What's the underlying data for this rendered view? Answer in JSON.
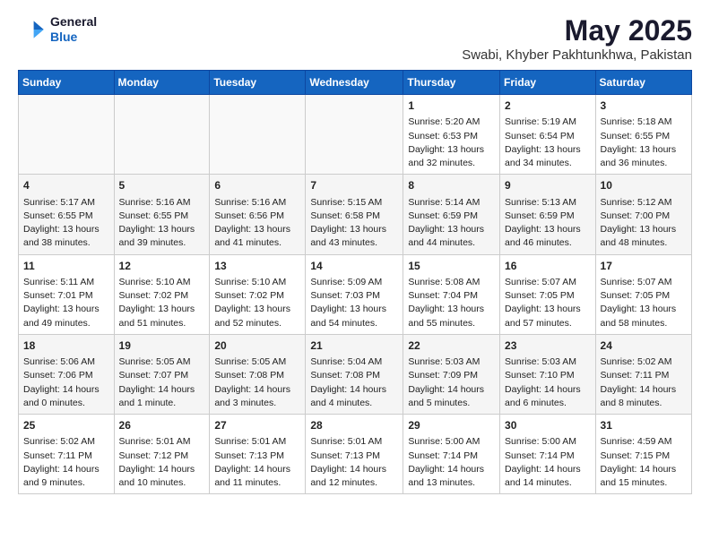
{
  "header": {
    "logo_line1": "General",
    "logo_line2": "Blue",
    "title": "May 2025",
    "subtitle": "Swabi, Khyber Pakhtunkhwa, Pakistan"
  },
  "days_of_week": [
    "Sunday",
    "Monday",
    "Tuesday",
    "Wednesday",
    "Thursday",
    "Friday",
    "Saturday"
  ],
  "weeks": [
    [
      {
        "day": "",
        "info": ""
      },
      {
        "day": "",
        "info": ""
      },
      {
        "day": "",
        "info": ""
      },
      {
        "day": "",
        "info": ""
      },
      {
        "day": "1",
        "info": "Sunrise: 5:20 AM\nSunset: 6:53 PM\nDaylight: 13 hours\nand 32 minutes."
      },
      {
        "day": "2",
        "info": "Sunrise: 5:19 AM\nSunset: 6:54 PM\nDaylight: 13 hours\nand 34 minutes."
      },
      {
        "day": "3",
        "info": "Sunrise: 5:18 AM\nSunset: 6:55 PM\nDaylight: 13 hours\nand 36 minutes."
      }
    ],
    [
      {
        "day": "4",
        "info": "Sunrise: 5:17 AM\nSunset: 6:55 PM\nDaylight: 13 hours\nand 38 minutes."
      },
      {
        "day": "5",
        "info": "Sunrise: 5:16 AM\nSunset: 6:55 PM\nDaylight: 13 hours\nand 39 minutes."
      },
      {
        "day": "6",
        "info": "Sunrise: 5:16 AM\nSunset: 6:56 PM\nDaylight: 13 hours\nand 41 minutes."
      },
      {
        "day": "7",
        "info": "Sunrise: 5:15 AM\nSunset: 6:58 PM\nDaylight: 13 hours\nand 43 minutes."
      },
      {
        "day": "8",
        "info": "Sunrise: 5:14 AM\nSunset: 6:59 PM\nDaylight: 13 hours\nand 44 minutes."
      },
      {
        "day": "9",
        "info": "Sunrise: 5:13 AM\nSunset: 6:59 PM\nDaylight: 13 hours\nand 46 minutes."
      },
      {
        "day": "10",
        "info": "Sunrise: 5:12 AM\nSunset: 7:00 PM\nDaylight: 13 hours\nand 48 minutes."
      }
    ],
    [
      {
        "day": "11",
        "info": "Sunrise: 5:11 AM\nSunset: 7:01 PM\nDaylight: 13 hours\nand 49 minutes."
      },
      {
        "day": "12",
        "info": "Sunrise: 5:10 AM\nSunset: 7:02 PM\nDaylight: 13 hours\nand 51 minutes."
      },
      {
        "day": "13",
        "info": "Sunrise: 5:10 AM\nSunset: 7:02 PM\nDaylight: 13 hours\nand 52 minutes."
      },
      {
        "day": "14",
        "info": "Sunrise: 5:09 AM\nSunset: 7:03 PM\nDaylight: 13 hours\nand 54 minutes."
      },
      {
        "day": "15",
        "info": "Sunrise: 5:08 AM\nSunset: 7:04 PM\nDaylight: 13 hours\nand 55 minutes."
      },
      {
        "day": "16",
        "info": "Sunrise: 5:07 AM\nSunset: 7:05 PM\nDaylight: 13 hours\nand 57 minutes."
      },
      {
        "day": "17",
        "info": "Sunrise: 5:07 AM\nSunset: 7:05 PM\nDaylight: 13 hours\nand 58 minutes."
      }
    ],
    [
      {
        "day": "18",
        "info": "Sunrise: 5:06 AM\nSunset: 7:06 PM\nDaylight: 14 hours\nand 0 minutes."
      },
      {
        "day": "19",
        "info": "Sunrise: 5:05 AM\nSunset: 7:07 PM\nDaylight: 14 hours\nand 1 minute."
      },
      {
        "day": "20",
        "info": "Sunrise: 5:05 AM\nSunset: 7:08 PM\nDaylight: 14 hours\nand 3 minutes."
      },
      {
        "day": "21",
        "info": "Sunrise: 5:04 AM\nSunset: 7:08 PM\nDaylight: 14 hours\nand 4 minutes."
      },
      {
        "day": "22",
        "info": "Sunrise: 5:03 AM\nSunset: 7:09 PM\nDaylight: 14 hours\nand 5 minutes."
      },
      {
        "day": "23",
        "info": "Sunrise: 5:03 AM\nSunset: 7:10 PM\nDaylight: 14 hours\nand 6 minutes."
      },
      {
        "day": "24",
        "info": "Sunrise: 5:02 AM\nSunset: 7:11 PM\nDaylight: 14 hours\nand 8 minutes."
      }
    ],
    [
      {
        "day": "25",
        "info": "Sunrise: 5:02 AM\nSunset: 7:11 PM\nDaylight: 14 hours\nand 9 minutes."
      },
      {
        "day": "26",
        "info": "Sunrise: 5:01 AM\nSunset: 7:12 PM\nDaylight: 14 hours\nand 10 minutes."
      },
      {
        "day": "27",
        "info": "Sunrise: 5:01 AM\nSunset: 7:13 PM\nDaylight: 14 hours\nand 11 minutes."
      },
      {
        "day": "28",
        "info": "Sunrise: 5:01 AM\nSunset: 7:13 PM\nDaylight: 14 hours\nand 12 minutes."
      },
      {
        "day": "29",
        "info": "Sunrise: 5:00 AM\nSunset: 7:14 PM\nDaylight: 14 hours\nand 13 minutes."
      },
      {
        "day": "30",
        "info": "Sunrise: 5:00 AM\nSunset: 7:14 PM\nDaylight: 14 hours\nand 14 minutes."
      },
      {
        "day": "31",
        "info": "Sunrise: 4:59 AM\nSunset: 7:15 PM\nDaylight: 14 hours\nand 15 minutes."
      }
    ]
  ]
}
